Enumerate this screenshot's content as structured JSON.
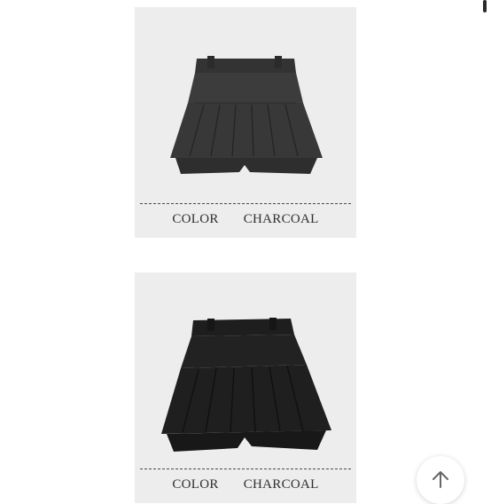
{
  "products": [
    {
      "color_label": "COLOR",
      "color_value": "CHARCOAL",
      "image": "charcoal-pleated-skort",
      "fabric_color": "#3a3a3a"
    },
    {
      "color_label": "COLOR",
      "color_value": "CHARCOAL",
      "image": "black-pleated-skort",
      "fabric_color": "#1c1c1c"
    }
  ],
  "scroll_top_button": {
    "icon": "arrow-up-icon"
  }
}
